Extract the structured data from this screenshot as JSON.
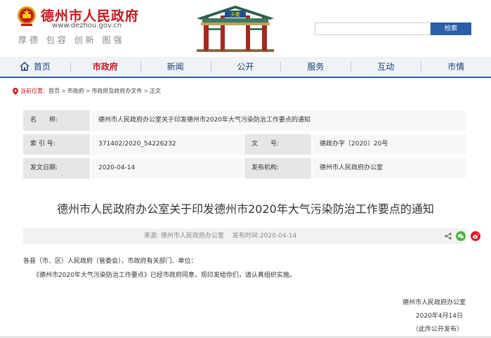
{
  "header": {
    "site_title": "德州市人民政府",
    "site_url": "www.dezhou.gov.cn",
    "motto": "厚德 包容 创新 图强",
    "gate_plaque": "天衢",
    "search_placeholder": "",
    "search_button": "检索"
  },
  "nav": {
    "items": [
      {
        "label": "首页"
      },
      {
        "label": "市政府"
      },
      {
        "label": "新闻"
      },
      {
        "label": "公开"
      },
      {
        "label": "服务"
      },
      {
        "label": "互动"
      },
      {
        "label": "市情"
      }
    ],
    "active": "市政府"
  },
  "breadcrumb": {
    "label": "当前位置：",
    "items": [
      "首页",
      "市政府",
      "市政府及政府办文件",
      "正文"
    ],
    "separator": ">"
  },
  "info": {
    "name_label": "名　　称:",
    "name_value": "德州市人民政府办公室关于印发德州市2020年大气污染防治工作要点的通知",
    "index_label": "索 引 号:",
    "index_value": "371402/2020_54226232",
    "docno_label": "文　　号:",
    "docno_value": "德政办字〔2020〕20号",
    "date_label": "发文日期:",
    "date_value": "2020-04-14",
    "issuer_label": "发布机构:",
    "issuer_value": "德州市人民政府办公室"
  },
  "article": {
    "title": "德州市人民政府办公室关于印发德州市2020年大气污染防治工作要点的通知",
    "source": "来源: 德州市人民政府办公室",
    "publish_time": "发布时间:2020-04-14",
    "salutation": "各县（市、区）人民政府（管委会），市政府有关部门、单位：",
    "paragraph": "《德州市2020年大气污染防治工作要点》已经市政府同意，现印发给你们，请认真组织实施。",
    "signature_org": "德州市人民政府办公室",
    "signature_date": "2020年4月14日",
    "note": "（此件公开发布）"
  },
  "colors": {
    "brand_red": "#c8161d",
    "nav_blue": "#2a5ea8",
    "label_gray": "#e6e6e6",
    "value_gray": "#f7f7f7"
  },
  "icons": [
    "emblem-icon",
    "home-icon",
    "location-icon",
    "share-icon",
    "wechat-icon",
    "weibo-icon"
  ]
}
